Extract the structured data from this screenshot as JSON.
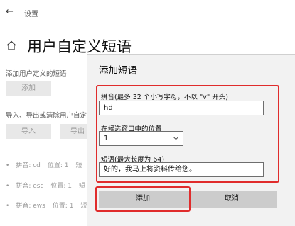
{
  "window": {
    "back_glyph": "←",
    "title": "设置"
  },
  "page": {
    "title": "用户自定义短语",
    "section1_label": "添加用户定义的短语",
    "add_button": "添加",
    "section2_label": "导入、导出或清除用户自定",
    "import_button": "导入",
    "export_button": "导出"
  },
  "phrase_list": [
    {
      "bullet": "•",
      "pinyin": "拼音: cd",
      "position": "位置: 1",
      "phrase": "短"
    },
    {
      "bullet": "•",
      "pinyin": "拼音: esc",
      "position": "位置: 1",
      "phrase": "短"
    },
    {
      "bullet": "•",
      "pinyin": "拼音: ews",
      "position": "位置: 1",
      "phrase": "短"
    }
  ],
  "dialog": {
    "title": "添加短语",
    "pinyin_label": "拼音(最多 32 个小写字母，不以 \"v\" 开头)",
    "pinyin_value": "hd",
    "position_label": "在候选窗口中的位置",
    "position_value": "1",
    "phrase_label": "短语(最大长度为 64)",
    "phrase_value": "好的，我马上将资料传给您。",
    "add_button": "添加",
    "cancel_button": "取消"
  },
  "colors": {
    "highlight": "#e02c2c",
    "button_bg": "#cccccc",
    "dialog_bg": "#f2f2f2"
  },
  "icons": {
    "back": "arrow-left-icon",
    "home": "home-icon",
    "dropdown": "chevron-down-icon"
  }
}
